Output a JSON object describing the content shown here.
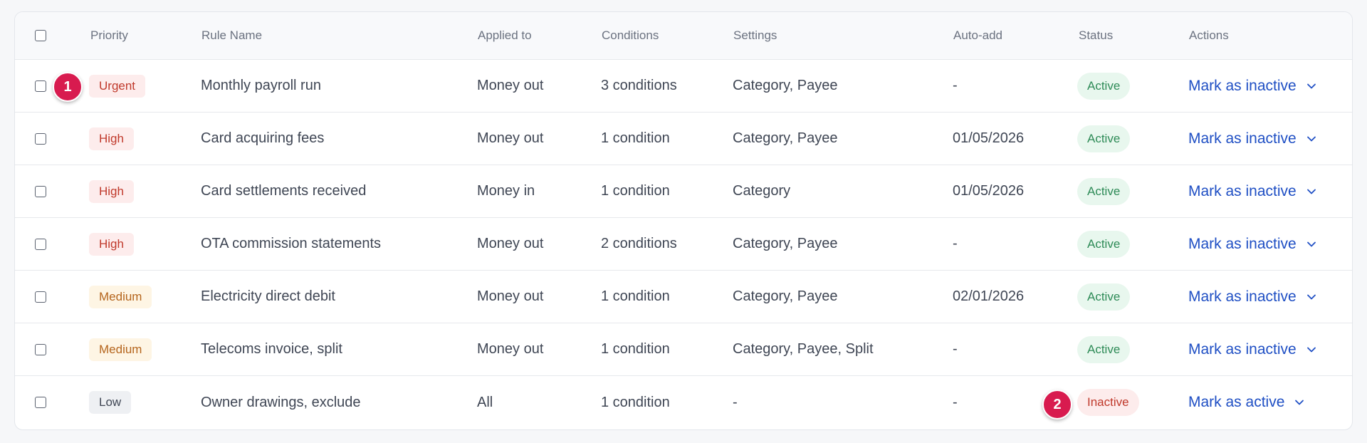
{
  "colors": {
    "priority": {
      "Urgent": {
        "bg": "#fdecec",
        "fg": "#c0392b"
      },
      "High": {
        "bg": "#fdecec",
        "fg": "#c0392b"
      },
      "Medium": {
        "bg": "#fef5e4",
        "fg": "#b5651d"
      },
      "Low": {
        "bg": "#eef0f3",
        "fg": "#3f4654"
      }
    },
    "status": {
      "Active": {
        "bg": "#e8f7ee",
        "fg": "#2e8b57"
      },
      "Inactive": {
        "bg": "#fdecec",
        "fg": "#c0392b"
      }
    },
    "link": "#1f4fc4",
    "marker": "#d81b4f"
  },
  "header": {
    "priority": "Priority",
    "rule_name": "Rule Name",
    "applied_to": "Applied to",
    "conditions": "Conditions",
    "settings": "Settings",
    "auto_add": "Auto-add",
    "status": "Status",
    "actions": "Actions"
  },
  "rows": [
    {
      "priority": "Urgent",
      "rule_name": "Monthly payroll run",
      "applied_to": "Money out",
      "conditions": "3 conditions",
      "settings": "Category, Payee",
      "auto_add": "-",
      "status": "Active",
      "action": "Mark as inactive"
    },
    {
      "priority": "High",
      "rule_name": "Card acquiring fees",
      "applied_to": "Money out",
      "conditions": "1 condition",
      "settings": "Category, Payee",
      "auto_add": "01/05/2026",
      "status": "Active",
      "action": "Mark as inactive"
    },
    {
      "priority": "High",
      "rule_name": "Card settlements received",
      "applied_to": "Money in",
      "conditions": "1 condition",
      "settings": "Category",
      "auto_add": "01/05/2026",
      "status": "Active",
      "action": "Mark as inactive"
    },
    {
      "priority": "High",
      "rule_name": "OTA commission statements",
      "applied_to": "Money out",
      "conditions": "2 conditions",
      "settings": "Category, Payee",
      "auto_add": "-",
      "status": "Active",
      "action": "Mark as inactive"
    },
    {
      "priority": "Medium",
      "rule_name": "Electricity direct debit",
      "applied_to": "Money out",
      "conditions": "1 condition",
      "settings": "Category, Payee",
      "auto_add": "02/01/2026",
      "status": "Active",
      "action": "Mark as inactive"
    },
    {
      "priority": "Medium",
      "rule_name": "Telecoms invoice, split",
      "applied_to": "Money out",
      "conditions": "1 condition",
      "settings": "Category, Payee, Split",
      "auto_add": "-",
      "status": "Active",
      "action": "Mark as inactive"
    },
    {
      "priority": "Low",
      "rule_name": "Owner drawings, exclude",
      "applied_to": "All",
      "conditions": "1 condition",
      "settings": "-",
      "auto_add": "-",
      "status": "Inactive",
      "action": "Mark as active"
    }
  ],
  "markers": [
    "1",
    "2"
  ]
}
